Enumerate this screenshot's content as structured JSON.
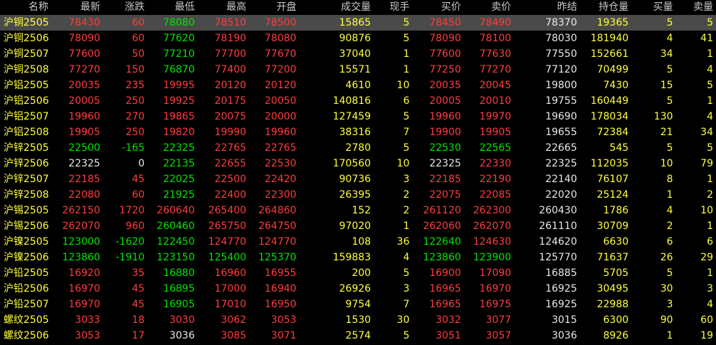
{
  "colors": {
    "background": "#000000",
    "up": "#ff3c3c",
    "down": "#00e600",
    "flat": "#e8e8e8",
    "volume": "#ffff3c",
    "header": "#c8c8c8",
    "selected_row": "#4a4a4a"
  },
  "headers": [
    "名称",
    "最新",
    "涨跌",
    "最低",
    "最高",
    "开盘",
    "成交量",
    "现手",
    "买价",
    "卖价",
    "昨结",
    "持仓量",
    "买量",
    "卖量"
  ],
  "rows": [
    {
      "name": "沪铜2505",
      "last": "78430",
      "chg": "60",
      "low": "78080",
      "high": "78510",
      "open": "78500",
      "vol": "15865",
      "cur": "5",
      "bid": "78450",
      "ask": "78490",
      "prev": "78370",
      "oi": "19365",
      "bidv": "5",
      "askv": "5",
      "c": {
        "last": "u",
        "chg": "u",
        "low": "d",
        "high": "u",
        "open": "u",
        "bid": "u",
        "ask": "u"
      }
    },
    {
      "name": "沪铜2506",
      "last": "78090",
      "chg": "60",
      "low": "77620",
      "high": "78190",
      "open": "78080",
      "vol": "90876",
      "cur": "5",
      "bid": "78090",
      "ask": "78100",
      "prev": "78030",
      "oi": "181940",
      "bidv": "4",
      "askv": "41",
      "c": {
        "last": "u",
        "chg": "u",
        "low": "d",
        "high": "u",
        "open": "u",
        "bid": "u",
        "ask": "u"
      }
    },
    {
      "name": "沪铜2507",
      "last": "77600",
      "chg": "50",
      "low": "77210",
      "high": "77700",
      "open": "77670",
      "vol": "37040",
      "cur": "1",
      "bid": "77600",
      "ask": "77630",
      "prev": "77550",
      "oi": "152661",
      "bidv": "34",
      "askv": "1",
      "c": {
        "last": "u",
        "chg": "u",
        "low": "d",
        "high": "u",
        "open": "u",
        "bid": "u",
        "ask": "u"
      }
    },
    {
      "name": "沪铜2508",
      "last": "77270",
      "chg": "150",
      "low": "76870",
      "high": "77400",
      "open": "77200",
      "vol": "15571",
      "cur": "1",
      "bid": "77250",
      "ask": "77270",
      "prev": "77120",
      "oi": "70499",
      "bidv": "5",
      "askv": "4",
      "c": {
        "last": "u",
        "chg": "u",
        "low": "d",
        "high": "u",
        "open": "u",
        "bid": "u",
        "ask": "u"
      }
    },
    {
      "name": "沪铝2505",
      "last": "20035",
      "chg": "235",
      "low": "19995",
      "high": "20120",
      "open": "20120",
      "vol": "4610",
      "cur": "10",
      "bid": "20035",
      "ask": "20045",
      "prev": "19800",
      "oi": "7430",
      "bidv": "15",
      "askv": "5",
      "c": {
        "last": "u",
        "chg": "u",
        "low": "u",
        "high": "u",
        "open": "u",
        "bid": "u",
        "ask": "u"
      }
    },
    {
      "name": "沪铝2506",
      "last": "20005",
      "chg": "250",
      "low": "19925",
      "high": "20175",
      "open": "20050",
      "vol": "140816",
      "cur": "6",
      "bid": "20005",
      "ask": "20010",
      "prev": "19755",
      "oi": "160449",
      "bidv": "5",
      "askv": "1",
      "c": {
        "last": "u",
        "chg": "u",
        "low": "u",
        "high": "u",
        "open": "u",
        "bid": "u",
        "ask": "u"
      }
    },
    {
      "name": "沪铝2507",
      "last": "19960",
      "chg": "270",
      "low": "19865",
      "high": "20075",
      "open": "20000",
      "vol": "127459",
      "cur": "5",
      "bid": "19960",
      "ask": "19970",
      "prev": "19690",
      "oi": "178034",
      "bidv": "130",
      "askv": "4",
      "c": {
        "last": "u",
        "chg": "u",
        "low": "u",
        "high": "u",
        "open": "u",
        "bid": "u",
        "ask": "u"
      }
    },
    {
      "name": "沪铝2508",
      "last": "19905",
      "chg": "250",
      "low": "19820",
      "high": "19990",
      "open": "19960",
      "vol": "38316",
      "cur": "7",
      "bid": "19900",
      "ask": "19905",
      "prev": "19655",
      "oi": "72384",
      "bidv": "21",
      "askv": "34",
      "c": {
        "last": "u",
        "chg": "u",
        "low": "u",
        "high": "u",
        "open": "u",
        "bid": "u",
        "ask": "u"
      }
    },
    {
      "name": "沪锌2505",
      "last": "22500",
      "chg": "-165",
      "low": "22325",
      "high": "22765",
      "open": "22765",
      "vol": "2780",
      "cur": "5",
      "bid": "22530",
      "ask": "22565",
      "prev": "22665",
      "oi": "545",
      "bidv": "5",
      "askv": "5",
      "c": {
        "last": "d",
        "chg": "d",
        "low": "d",
        "high": "u",
        "open": "u",
        "bid": "d",
        "ask": "d"
      }
    },
    {
      "name": "沪锌2506",
      "last": "22325",
      "chg": "0",
      "low": "22135",
      "high": "22655",
      "open": "22530",
      "vol": "170560",
      "cur": "10",
      "bid": "22325",
      "ask": "22330",
      "prev": "22325",
      "oi": "112035",
      "bidv": "10",
      "askv": "79",
      "c": {
        "last": "f",
        "chg": "f",
        "low": "d",
        "high": "u",
        "open": "u",
        "bid": "f",
        "ask": "u"
      }
    },
    {
      "name": "沪锌2507",
      "last": "22185",
      "chg": "45",
      "low": "22025",
      "high": "22500",
      "open": "22420",
      "vol": "90736",
      "cur": "3",
      "bid": "22185",
      "ask": "22190",
      "prev": "22140",
      "oi": "76107",
      "bidv": "8",
      "askv": "1",
      "c": {
        "last": "u",
        "chg": "u",
        "low": "d",
        "high": "u",
        "open": "u",
        "bid": "u",
        "ask": "u"
      }
    },
    {
      "name": "沪锌2508",
      "last": "22080",
      "chg": "60",
      "low": "21925",
      "high": "22400",
      "open": "22300",
      "vol": "26395",
      "cur": "2",
      "bid": "22075",
      "ask": "22085",
      "prev": "22020",
      "oi": "25124",
      "bidv": "1",
      "askv": "2",
      "c": {
        "last": "u",
        "chg": "u",
        "low": "d",
        "high": "u",
        "open": "u",
        "bid": "u",
        "ask": "u"
      }
    },
    {
      "name": "沪锡2505",
      "last": "262150",
      "chg": "1720",
      "low": "260640",
      "high": "265400",
      "open": "264860",
      "vol": "152",
      "cur": "2",
      "bid": "261120",
      "ask": "262300",
      "prev": "260430",
      "oi": "1786",
      "bidv": "4",
      "askv": "10",
      "c": {
        "last": "u",
        "chg": "u",
        "low": "u",
        "high": "u",
        "open": "u",
        "bid": "u",
        "ask": "u"
      }
    },
    {
      "name": "沪锡2506",
      "last": "262070",
      "chg": "960",
      "low": "260460",
      "high": "265750",
      "open": "264750",
      "vol": "97020",
      "cur": "1",
      "bid": "262060",
      "ask": "262070",
      "prev": "261110",
      "oi": "30709",
      "bidv": "2",
      "askv": "1",
      "c": {
        "last": "u",
        "chg": "u",
        "low": "d",
        "high": "u",
        "open": "u",
        "bid": "u",
        "ask": "u"
      }
    },
    {
      "name": "沪镍2505",
      "last": "123000",
      "chg": "-1620",
      "low": "122450",
      "high": "124770",
      "open": "124770",
      "vol": "108",
      "cur": "36",
      "bid": "122640",
      "ask": "124630",
      "prev": "124620",
      "oi": "6630",
      "bidv": "6",
      "askv": "6",
      "c": {
        "last": "d",
        "chg": "d",
        "low": "d",
        "high": "u",
        "open": "u",
        "bid": "d",
        "ask": "u"
      }
    },
    {
      "name": "沪镍2506",
      "last": "123860",
      "chg": "-1910",
      "low": "123150",
      "high": "125400",
      "open": "125370",
      "vol": "159883",
      "cur": "4",
      "bid": "123860",
      "ask": "123900",
      "prev": "125770",
      "oi": "71637",
      "bidv": "26",
      "askv": "29",
      "c": {
        "last": "d",
        "chg": "d",
        "low": "d",
        "high": "d",
        "open": "d",
        "bid": "d",
        "ask": "d"
      }
    },
    {
      "name": "沪铅2505",
      "last": "16920",
      "chg": "35",
      "low": "16880",
      "high": "16960",
      "open": "16955",
      "vol": "200",
      "cur": "5",
      "bid": "16900",
      "ask": "17090",
      "prev": "16885",
      "oi": "5705",
      "bidv": "5",
      "askv": "1",
      "c": {
        "last": "u",
        "chg": "u",
        "low": "d",
        "high": "u",
        "open": "u",
        "bid": "u",
        "ask": "u"
      }
    },
    {
      "name": "沪铅2506",
      "last": "16970",
      "chg": "45",
      "low": "16895",
      "high": "17000",
      "open": "16940",
      "vol": "26926",
      "cur": "3",
      "bid": "16965",
      "ask": "16970",
      "prev": "16925",
      "oi": "30495",
      "bidv": "30",
      "askv": "3",
      "c": {
        "last": "u",
        "chg": "u",
        "low": "d",
        "high": "u",
        "open": "u",
        "bid": "u",
        "ask": "u"
      }
    },
    {
      "name": "沪铅2507",
      "last": "16970",
      "chg": "45",
      "low": "16905",
      "high": "17010",
      "open": "16950",
      "vol": "9754",
      "cur": "7",
      "bid": "16965",
      "ask": "16975",
      "prev": "16925",
      "oi": "22988",
      "bidv": "3",
      "askv": "4",
      "c": {
        "last": "u",
        "chg": "u",
        "low": "d",
        "high": "u",
        "open": "u",
        "bid": "u",
        "ask": "u"
      }
    },
    {
      "name": "螺纹2505",
      "last": "3033",
      "chg": "18",
      "low": "3030",
      "high": "3062",
      "open": "3053",
      "vol": "1530",
      "cur": "30",
      "bid": "3032",
      "ask": "3077",
      "prev": "3015",
      "oi": "6300",
      "bidv": "90",
      "askv": "60",
      "c": {
        "last": "u",
        "chg": "u",
        "low": "u",
        "high": "u",
        "open": "u",
        "bid": "u",
        "ask": "u"
      }
    },
    {
      "name": "螺纹2506",
      "last": "3053",
      "chg": "17",
      "low": "3036",
      "high": "3085",
      "open": "3071",
      "vol": "2574",
      "cur": "5",
      "bid": "3051",
      "ask": "3057",
      "prev": "3036",
      "oi": "8926",
      "bidv": "1",
      "askv": "19",
      "c": {
        "last": "u",
        "chg": "u",
        "low": "f",
        "high": "u",
        "open": "u",
        "bid": "u",
        "ask": "u"
      }
    }
  ]
}
